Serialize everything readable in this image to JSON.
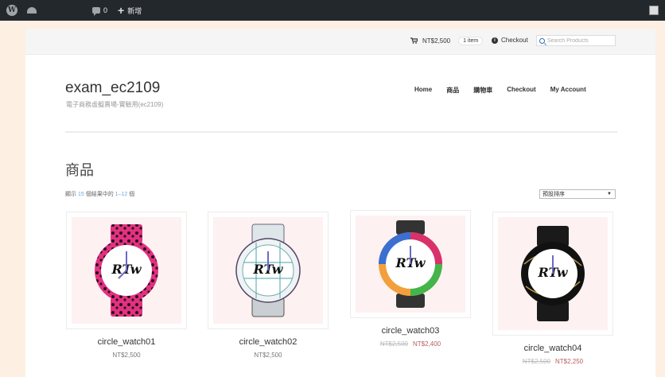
{
  "adminbar": {
    "comment_count": "0",
    "new_label": "新增"
  },
  "topbar": {
    "cart_total": "NT$2,500",
    "cart_count": "1 item",
    "checkout_label": "Checkout",
    "search_placeholder": "Search Products"
  },
  "site": {
    "title": "exam_ec2109",
    "tagline": "電子商務虛擬賣場-實驗用(ec2109)"
  },
  "nav": [
    "Home",
    "商品",
    "購物車",
    "Checkout",
    "My Account"
  ],
  "shop": {
    "page_title": "商品",
    "result_prefix": "顯示",
    "result_total": "15",
    "result_middle": "個結果中的",
    "result_range": "1–12",
    "result_suffix": "個",
    "sort_selected": "預設排序"
  },
  "products": [
    {
      "name": "circle_watch01",
      "price": "NT$2,500",
      "old_price": "",
      "sale_price": ""
    },
    {
      "name": "circle_watch02",
      "price": "NT$2,500",
      "old_price": "",
      "sale_price": ""
    },
    {
      "name": "circle_watch03",
      "price": "",
      "old_price": "NT$2,500",
      "sale_price": "NT$2,400"
    },
    {
      "name": "circle_watch04",
      "price": "",
      "old_price": "NT$2,500",
      "sale_price": "NT$2,250"
    }
  ],
  "colors": {
    "adminbar": "#23282d",
    "accent": "#2e6fb8",
    "sale": "#b85c5c",
    "page_bg": "#fdf0e3"
  }
}
